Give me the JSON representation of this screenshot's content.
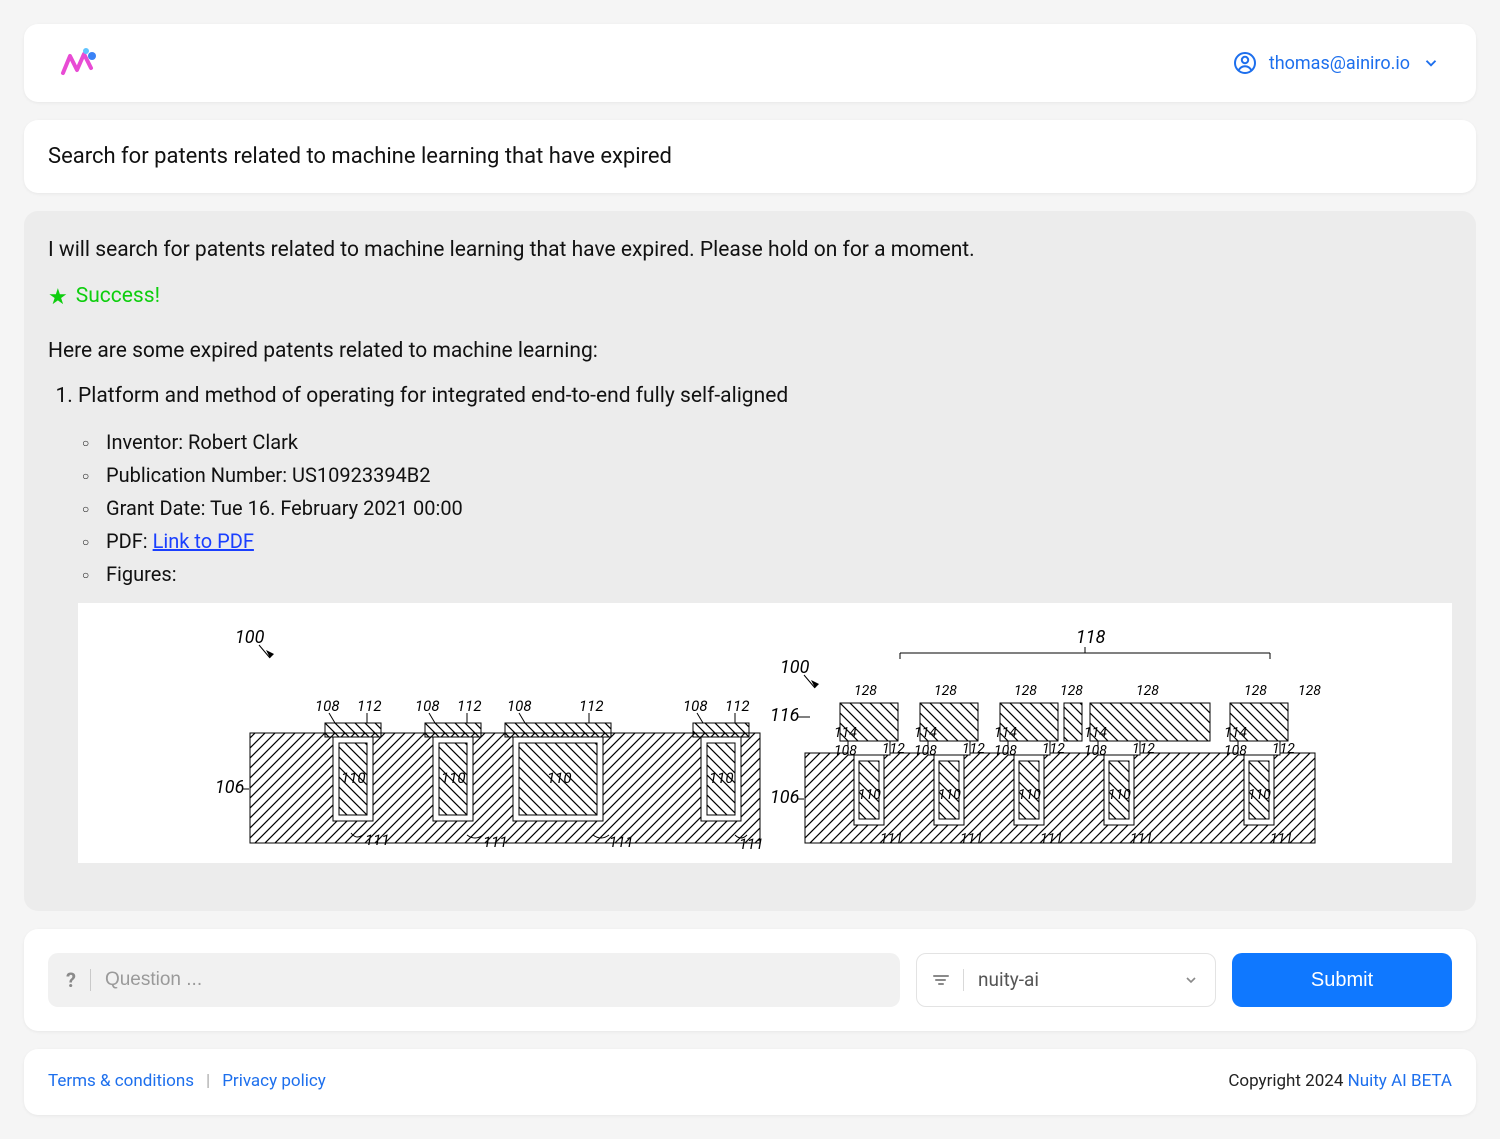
{
  "header": {
    "user_email": "thomas@ainiro.io"
  },
  "query": {
    "text": "Search for patents related to machine learning that have expired"
  },
  "result": {
    "intro": "I will search for patents related to machine learning that have expired. Please hold on for a moment.",
    "success_label": "Success!",
    "intro2": "Here are some expired patents related to machine learning:",
    "patent": {
      "title": "Platform and method of operating for integrated end-to-end fully self-aligned",
      "inventor_label": "Inventor:",
      "inventor": "Robert Clark",
      "pubnum_label": "Publication Number:",
      "pubnum": "US10923394B2",
      "grant_label": "Grant Date:",
      "grant": "Tue 16. February 2021 00:00",
      "pdf_label": "PDF:",
      "pdf_link_text": "Link to PDF",
      "figures_label": "Figures:"
    }
  },
  "input_bar": {
    "placeholder": "Question ...",
    "model": "nuity-ai",
    "submit_label": "Submit"
  },
  "footer": {
    "terms": "Terms & conditions",
    "privacy": "Privacy policy",
    "copyright_prefix": "Copyright 2024 ",
    "brand": "Nuity AI BETA"
  },
  "figure_numbers": {
    "left": {
      "top": "100",
      "substrate": "106",
      "labels": [
        "108",
        "112",
        "110",
        "111"
      ]
    },
    "right": {
      "top": "100",
      "substrate": "106",
      "top_brace": "118",
      "side": "116",
      "labels": [
        "128",
        "114",
        "108",
        "112",
        "110",
        "111"
      ]
    }
  }
}
